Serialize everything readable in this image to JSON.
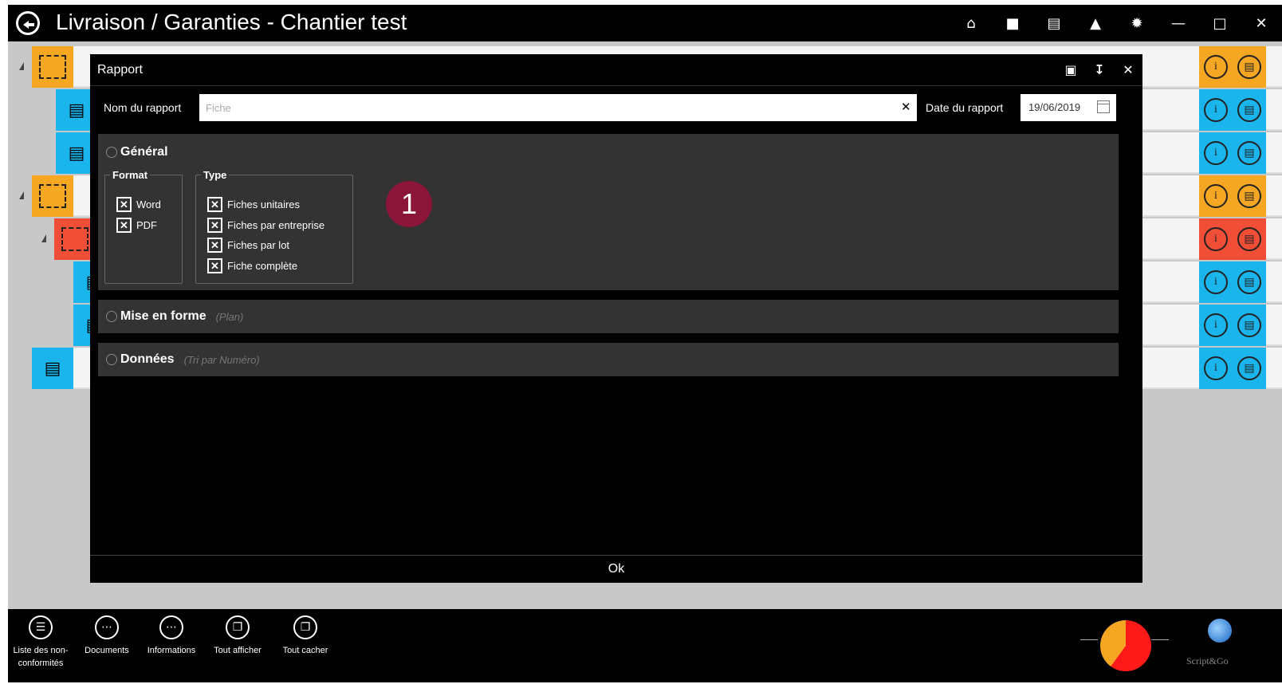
{
  "window": {
    "title": "Livraison / Garanties - Chantier test",
    "icons": [
      "home-icon",
      "folder-icon",
      "document-icon",
      "user-icon",
      "settings-icon",
      "minimize-icon",
      "maximize-icon",
      "close-icon"
    ]
  },
  "colors": {
    "orange": "#f5a623",
    "blue": "#1ab5ec",
    "red": "#f04e37",
    "badge": "#8a1538"
  },
  "modal": {
    "title": "Rapport",
    "name_label": "Nom du rapport",
    "name_placeholder": "Fiche",
    "date_label": "Date du rapport",
    "date_value": "19/06/2019",
    "sections": {
      "general": {
        "title": "Général",
        "format": {
          "legend": "Format",
          "options": [
            {
              "label": "Word",
              "checked": true
            },
            {
              "label": "PDF",
              "checked": true
            }
          ]
        },
        "type": {
          "legend": "Type",
          "options": [
            {
              "label": "Fiches unitaires",
              "checked": true
            },
            {
              "label": "Fiches par entreprise",
              "checked": true
            },
            {
              "label": "Fiches par lot",
              "checked": true
            },
            {
              "label": "Fiche complète",
              "checked": true
            }
          ]
        }
      },
      "mise_en_forme": {
        "title": "Mise en forme",
        "subtitle": "(Plan)"
      },
      "donnees": {
        "title": "Données",
        "subtitle": "(Tri par Numéro)"
      }
    },
    "ok_label": "Ok"
  },
  "callout": "1",
  "bottombar": {
    "items": [
      {
        "label": "Liste des non-conformités",
        "icon": "list-icon"
      },
      {
        "label": "Documents",
        "icon": "more-icon"
      },
      {
        "label": "Informations",
        "icon": "more-icon"
      },
      {
        "label": "Tout afficher",
        "icon": "copy-icon"
      },
      {
        "label": "Tout cacher",
        "icon": "copy-icon"
      }
    ],
    "brand": "Script&Go"
  }
}
